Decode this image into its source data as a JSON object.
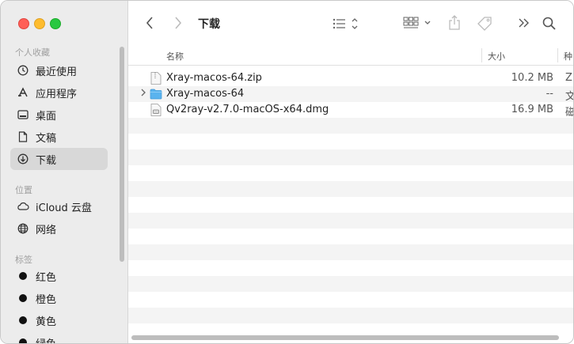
{
  "window": {
    "title": "下载"
  },
  "sidebar": {
    "favorites_title": "个人收藏",
    "favorites": [
      {
        "label": "最近使用",
        "icon": "clock-icon"
      },
      {
        "label": "应用程序",
        "icon": "apps-icon"
      },
      {
        "label": "桌面",
        "icon": "desktop-icon"
      },
      {
        "label": "文稿",
        "icon": "document-icon"
      },
      {
        "label": "下载",
        "icon": "download-icon",
        "selected": true
      }
    ],
    "locations_title": "位置",
    "locations": [
      {
        "label": "iCloud 云盘",
        "icon": "cloud-icon"
      },
      {
        "label": "网络",
        "icon": "globe-icon"
      }
    ],
    "tags_title": "标签",
    "tags": [
      {
        "label": "红色"
      },
      {
        "label": "橙色"
      },
      {
        "label": "黄色"
      },
      {
        "label": "绿色"
      }
    ]
  },
  "columns": {
    "name": "名称",
    "size": "大小",
    "kind": "种"
  },
  "files": [
    {
      "name": "Xray-macos-64.zip",
      "size": "10.2 MB",
      "kind": "ZI",
      "icon": "zip-file-icon"
    },
    {
      "name": "Xray-macos-64",
      "size": "--",
      "kind": "文",
      "icon": "folder-icon",
      "expandable": true
    },
    {
      "name": "Qv2ray-v2.7.0-macOS-x64.dmg",
      "size": "16.9 MB",
      "kind": "磁",
      "icon": "dmg-file-icon"
    }
  ]
}
